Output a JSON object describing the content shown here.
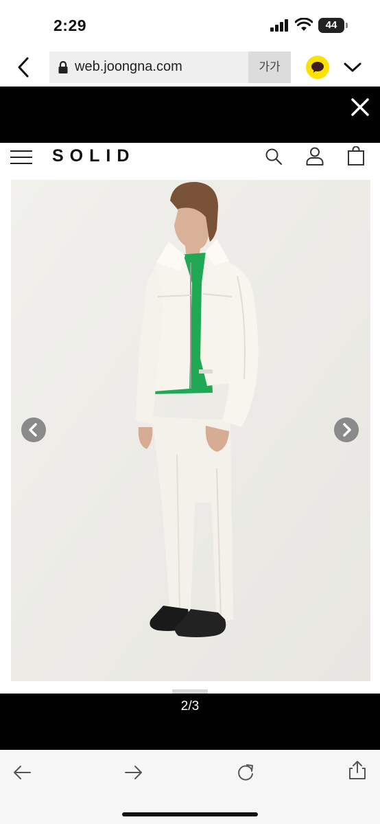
{
  "status_bar": {
    "time": "2:29",
    "battery": "44"
  },
  "browser": {
    "url": "web.joongna.com",
    "text_size_label": "가가"
  },
  "site": {
    "logo": "SOLID"
  },
  "gallery": {
    "counter": "2/3"
  },
  "colors": {
    "kakao_yellow": "#fae100",
    "overlay": "#000000",
    "image_background": "#eeede9",
    "shirt_green": "#1fa955"
  },
  "icons": {
    "back": "chevron-left-icon",
    "lock": "lock-icon",
    "kakao": "kakao-chat-icon",
    "menu": "chevron-down-icon",
    "close": "close-icon",
    "hamburger": "hamburger-icon",
    "search": "search-icon",
    "user": "user-icon",
    "bag": "shopping-bag-icon",
    "prev": "arrow-left-circle-icon",
    "next": "arrow-right-circle-icon",
    "toolbar_back": "arrow-left-icon",
    "toolbar_forward": "arrow-right-icon",
    "reload": "reload-icon",
    "share": "share-icon"
  }
}
